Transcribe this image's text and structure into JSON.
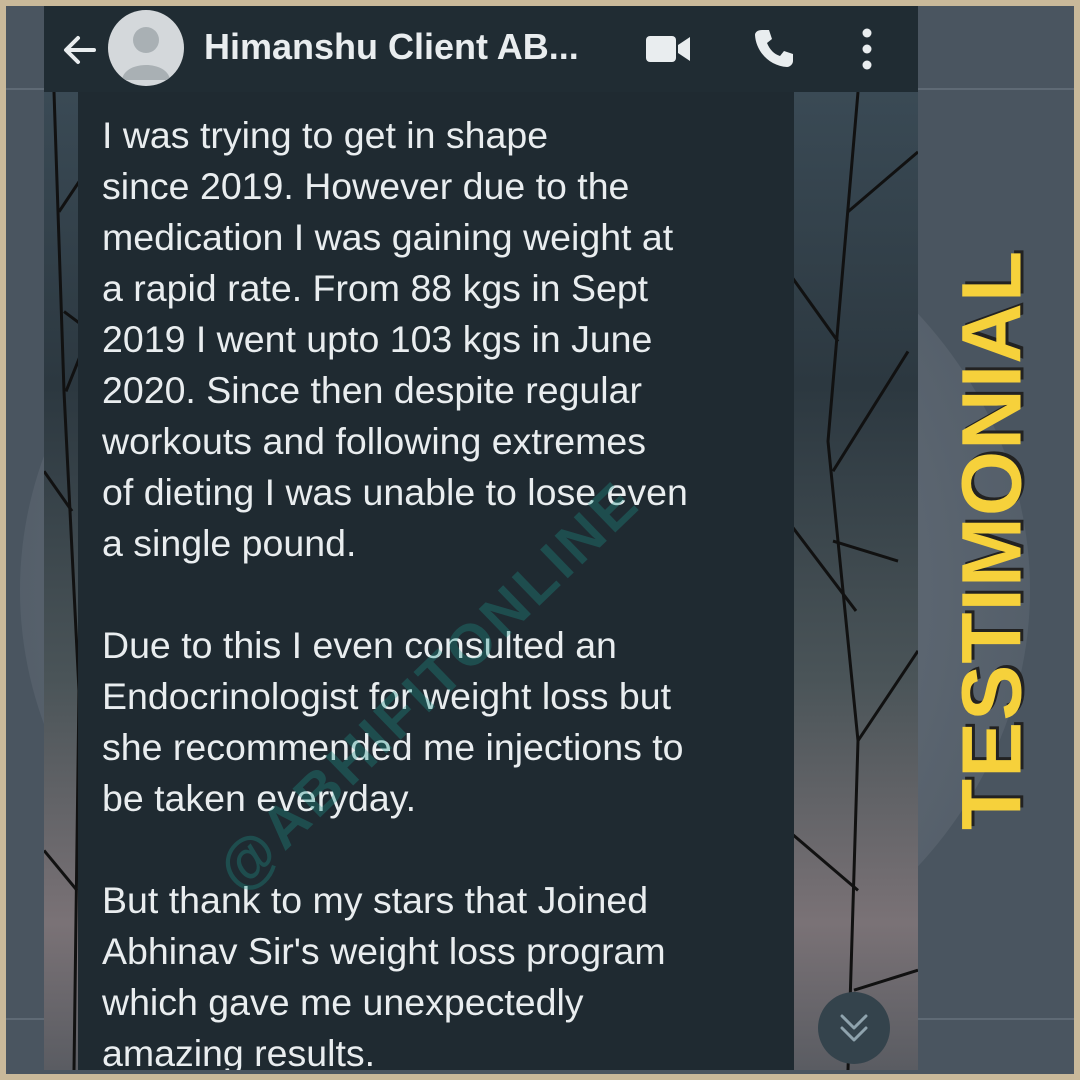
{
  "header": {
    "contact_name": "Himanshu Client AB..."
  },
  "message": {
    "text": "I was trying to get in shape\nsince 2019. However due to the\nmedication I was gaining weight at\na rapid rate. From 88 kgs in Sept\n2019 I went upto 103 kgs in  June\n2020. Since then despite regular\nworkouts and following extremes\nof dieting I was unable to lose even\na single pound.\n\nDue to this I even consulted an\nEndocrinologist for weight loss but\nshe recommended me injections to\nbe taken everyday.\n\nBut thank to my stars that Joined\nAbhinav Sir's weight loss program\nwhich gave me unexpectedly\namazing results."
  },
  "watermark": "@ABHIFITONLINE",
  "side_label": "TESTIMONIAL",
  "icons": {
    "back": "back-arrow-icon",
    "avatar": "avatar-icon",
    "video": "video-call-icon",
    "call": "phone-icon",
    "more": "more-vert-icon",
    "scroll": "chevron-double-down-icon"
  },
  "colors": {
    "accent_yellow": "#f6d13b",
    "chat_bg": "#1f2a31",
    "text": "#e9edef"
  }
}
